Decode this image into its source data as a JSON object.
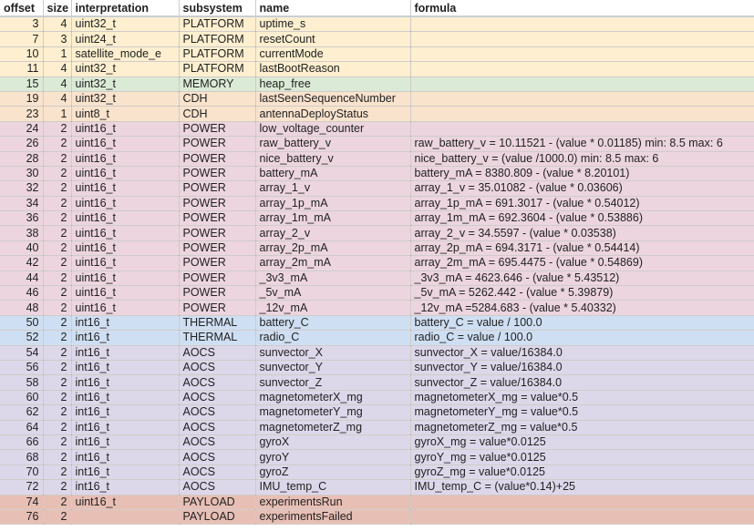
{
  "headers": {
    "offset": "offset",
    "size": "size",
    "interpretation": "interpretation",
    "subsystem": "subsystem",
    "name": "name",
    "formula": "formula"
  },
  "subsystem_colors": {
    "PLATFORM": "#fdefcf",
    "MEMORY": "#dbead6",
    "CDH": "#f9e3cd",
    "POWER": "#ecd5df",
    "THERMAL": "#cfdff3",
    "AOCS": "#ddd7ea",
    "PAYLOAD": "#e8bfb5"
  },
  "rows": [
    {
      "offset": "3",
      "size": "4",
      "interpretation": "uint32_t",
      "subsystem": "PLATFORM",
      "name": "uptime_s",
      "formula": ""
    },
    {
      "offset": "7",
      "size": "3",
      "interpretation": "uint24_t",
      "subsystem": "PLATFORM",
      "name": "resetCount",
      "formula": ""
    },
    {
      "offset": "10",
      "size": "1",
      "interpretation": "satellite_mode_e",
      "subsystem": "PLATFORM",
      "name": "currentMode",
      "formula": ""
    },
    {
      "offset": "11",
      "size": "4",
      "interpretation": "uint32_t",
      "subsystem": "PLATFORM",
      "name": "lastBootReason",
      "formula": ""
    },
    {
      "offset": "15",
      "size": "4",
      "interpretation": "uint32_t",
      "subsystem": "MEMORY",
      "name": "heap_free",
      "formula": ""
    },
    {
      "offset": "19",
      "size": "4",
      "interpretation": "uint32_t",
      "subsystem": "CDH",
      "name": "lastSeenSequenceNumber",
      "formula": ""
    },
    {
      "offset": "23",
      "size": "1",
      "interpretation": "uint8_t",
      "subsystem": "CDH",
      "name": "antennaDeployStatus",
      "formula": ""
    },
    {
      "offset": "24",
      "size": "2",
      "interpretation": "uint16_t",
      "subsystem": "POWER",
      "name": "low_voltage_counter",
      "formula": ""
    },
    {
      "offset": "26",
      "size": "2",
      "interpretation": "uint16_t",
      "subsystem": "POWER",
      "name": "raw_battery_v",
      "formula": "raw_battery_v = 10.11521 - (value * 0.01185) min: 8.5 max: 6"
    },
    {
      "offset": "28",
      "size": "2",
      "interpretation": "uint16_t",
      "subsystem": "POWER",
      "name": "nice_battery_v",
      "formula": "nice_battery_v = (value /1000.0) min: 8.5 max: 6"
    },
    {
      "offset": "30",
      "size": "2",
      "interpretation": "uint16_t",
      "subsystem": "POWER",
      "name": "battery_mA",
      "formula": "battery_mA = 8380.809 - (value * 8.20101)"
    },
    {
      "offset": "32",
      "size": "2",
      "interpretation": "uint16_t",
      "subsystem": "POWER",
      "name": "array_1_v",
      "formula": "array_1_v = 35.01082 - (value * 0.03606)"
    },
    {
      "offset": "34",
      "size": "2",
      "interpretation": "uint16_t",
      "subsystem": "POWER",
      "name": "array_1p_mA",
      "formula": "array_1p_mA = 691.3017 - (value * 0.54012)"
    },
    {
      "offset": "36",
      "size": "2",
      "interpretation": "uint16_t",
      "subsystem": "POWER",
      "name": "array_1m_mA",
      "formula": "array_1m_mA = 692.3604 - (value * 0.53886)"
    },
    {
      "offset": "38",
      "size": "2",
      "interpretation": "uint16_t",
      "subsystem": "POWER",
      "name": "array_2_v",
      "formula": "array_2_v = 34.5597 - (value * 0.03538)"
    },
    {
      "offset": "40",
      "size": "2",
      "interpretation": "uint16_t",
      "subsystem": "POWER",
      "name": "array_2p_mA",
      "formula": "array_2p_mA = 694.3171 - (value * 0.54414)"
    },
    {
      "offset": "42",
      "size": "2",
      "interpretation": "uint16_t",
      "subsystem": "POWER",
      "name": "array_2m_mA",
      "formula": "array_2m_mA = 695.4475 - (value * 0.54869)"
    },
    {
      "offset": "44",
      "size": "2",
      "interpretation": "uint16_t",
      "subsystem": "POWER",
      "name": "_3v3_mA",
      "formula": "_3v3_mA = 4623.646 - (value * 5.43512)"
    },
    {
      "offset": "46",
      "size": "2",
      "interpretation": "uint16_t",
      "subsystem": "POWER",
      "name": "_5v_mA",
      "formula": "_5v_mA = 5262.442 - (value * 5.39879)"
    },
    {
      "offset": "48",
      "size": "2",
      "interpretation": "uint16_t",
      "subsystem": "POWER",
      "name": "_12v_mA",
      "formula": "_12v_mA =5284.683 - (value * 5.40332)"
    },
    {
      "offset": "50",
      "size": "2",
      "interpretation": "int16_t",
      "subsystem": "THERMAL",
      "name": "battery_C",
      "formula": "battery_C = value / 100.0"
    },
    {
      "offset": "52",
      "size": "2",
      "interpretation": "int16_t",
      "subsystem": "THERMAL",
      "name": "radio_C",
      "formula": "radio_C = value / 100.0"
    },
    {
      "offset": "54",
      "size": "2",
      "interpretation": "int16_t",
      "subsystem": "AOCS",
      "name": "sunvector_X",
      "formula": "sunvector_X = value/16384.0"
    },
    {
      "offset": "56",
      "size": "2",
      "interpretation": "int16_t",
      "subsystem": "AOCS",
      "name": "sunvector_Y",
      "formula": "sunvector_Y = value/16384.0"
    },
    {
      "offset": "58",
      "size": "2",
      "interpretation": "int16_t",
      "subsystem": "AOCS",
      "name": "sunvector_Z",
      "formula": "sunvector_Z = value/16384.0"
    },
    {
      "offset": "60",
      "size": "2",
      "interpretation": "int16_t",
      "subsystem": "AOCS",
      "name": "magnetometerX_mg",
      "formula": "magnetometerX_mg = value*0.5"
    },
    {
      "offset": "62",
      "size": "2",
      "interpretation": "int16_t",
      "subsystem": "AOCS",
      "name": "magnetometerY_mg",
      "formula": "magnetometerY_mg = value*0.5"
    },
    {
      "offset": "64",
      "size": "2",
      "interpretation": "int16_t",
      "subsystem": "AOCS",
      "name": "magnetometerZ_mg",
      "formula": "magnetometerZ_mg = value*0.5"
    },
    {
      "offset": "66",
      "size": "2",
      "interpretation": "int16_t",
      "subsystem": "AOCS",
      "name": "gyroX",
      "formula": "gyroX_mg = value*0.0125"
    },
    {
      "offset": "68",
      "size": "2",
      "interpretation": "int16_t",
      "subsystem": "AOCS",
      "name": "gyroY",
      "formula": "gyroY_mg = value*0.0125"
    },
    {
      "offset": "70",
      "size": "2",
      "interpretation": "int16_t",
      "subsystem": "AOCS",
      "name": "gyroZ",
      "formula": "gyroZ_mg = value*0.0125"
    },
    {
      "offset": "72",
      "size": "2",
      "interpretation": "int16_t",
      "subsystem": "AOCS",
      "name": "IMU_temp_C",
      "formula": "IMU_temp_C = (value*0.14)+25"
    },
    {
      "offset": "74",
      "size": "2",
      "interpretation": "uint16_t",
      "subsystem": "PAYLOAD",
      "name": "experimentsRun",
      "formula": ""
    },
    {
      "offset": "76",
      "size": "2",
      "interpretation": "",
      "subsystem": "PAYLOAD",
      "name": "experimentsFailed",
      "formula": ""
    }
  ]
}
